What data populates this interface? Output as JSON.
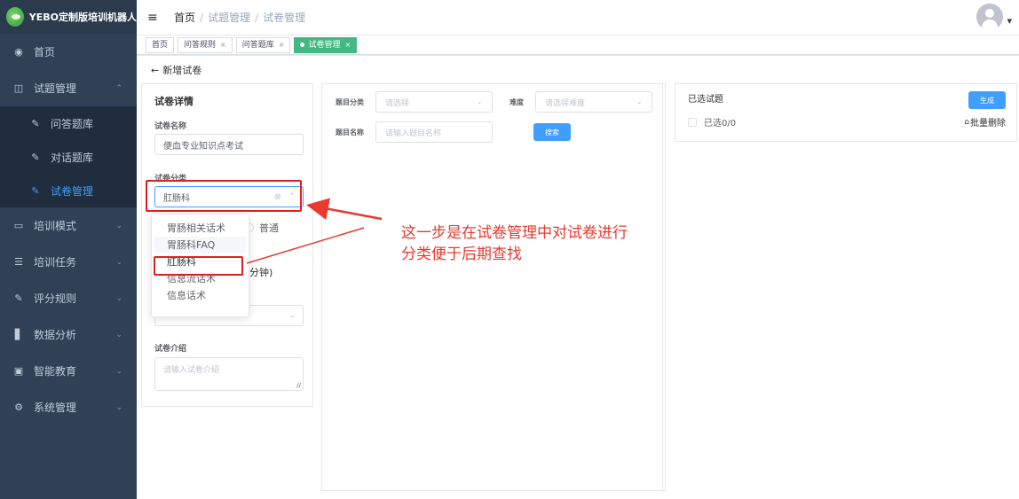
{
  "app": {
    "title": "YEBO定制版培训机器人"
  },
  "sidebar": {
    "items": [
      {
        "label": "首页",
        "icon": "dashboard-icon"
      },
      {
        "label": "试题管理",
        "icon": "book-icon",
        "expanded": true,
        "children": [
          {
            "label": "问答题库",
            "icon": "edit-icon"
          },
          {
            "label": "对话题库",
            "icon": "edit-icon"
          },
          {
            "label": "试卷管理",
            "icon": "edit-icon",
            "active": true
          }
        ]
      },
      {
        "label": "培训模式",
        "icon": "monitor-icon"
      },
      {
        "label": "培训任务",
        "icon": "list-icon"
      },
      {
        "label": "评分规则",
        "icon": "edit-icon"
      },
      {
        "label": "数据分析",
        "icon": "bar-chart-icon"
      },
      {
        "label": "智能教育",
        "icon": "presentation-icon"
      },
      {
        "label": "系统管理",
        "icon": "gear-icon"
      }
    ]
  },
  "header": {
    "breadcrumb": [
      "首页",
      "试题管理",
      "试卷管理"
    ]
  },
  "tags": [
    {
      "label": "首页",
      "closable": false
    },
    {
      "label": "问答规则",
      "closable": true
    },
    {
      "label": "问答题库",
      "closable": true
    },
    {
      "label": "试卷管理",
      "closable": true,
      "active": true
    }
  ],
  "page": {
    "back_label": "新增试卷"
  },
  "details": {
    "title": "试卷详情",
    "name_label": "试卷名称",
    "name_value": "便血专业知识点考试",
    "category_label": "试卷分类",
    "category_value": "肛肠科",
    "radio_fragment": "普通",
    "time_fragment": "分钟)",
    "intro_label": "试卷介绍",
    "intro_placeholder": "请输入试卷介绍"
  },
  "category_dropdown": {
    "options": [
      "胃肠相关话术",
      "胃肠科FAQ",
      "肛肠科",
      "信息流话术",
      "信息话术"
    ],
    "hovered_index": 1,
    "selected_index": 2
  },
  "filters": {
    "type_label": "题目分类",
    "type_placeholder": "请选择",
    "difficulty_label": "难度",
    "difficulty_placeholder": "请选择难度",
    "name_label": "题目名称",
    "name_placeholder": "请输入题目名称",
    "search_button": "搜索"
  },
  "selected": {
    "title": "已选试题",
    "generate_button": "生成",
    "count_label": "已选0/0",
    "batch_delete": "批量删除"
  },
  "annotation": {
    "line1": "这一步是在试卷管理中对试卷进行",
    "line2": "分类便于后期查找"
  },
  "colors": {
    "sidebar_bg": "#304156",
    "active_blue": "#409eff",
    "tag_green": "#42b983",
    "annotation_red": "#e83a2f"
  }
}
